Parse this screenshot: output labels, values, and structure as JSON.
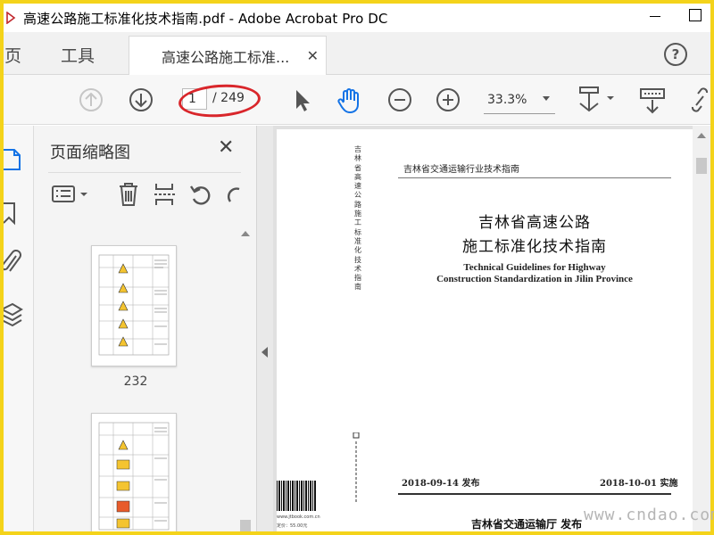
{
  "window": {
    "title": "高速公路施工标准化技术指南.pdf - Adobe Acrobat Pro DC"
  },
  "tabs": {
    "home": "主页",
    "tools": "工具",
    "document": "高速公路施工标准...",
    "close_glyph": "✕"
  },
  "toolbar": {
    "page_current": "1",
    "page_total": "/ 249",
    "zoom": "33.3%"
  },
  "thumbnails": {
    "title": "页面缩略图",
    "close_glyph": "✕",
    "pages": [
      {
        "label": "232"
      },
      {
        "label": ""
      }
    ]
  },
  "document": {
    "series": "吉林省交通运输行业技术指南",
    "spine_text": "吉林省高速公路施工标准化技术指南",
    "title_line1": "吉林省高速公路",
    "title_line2": "施工标准化技术指南",
    "english_line1": "Technical Guidelines for Highway",
    "english_line2": "Construction Standardization in Jilin Province",
    "publish_date": "2018-09-14 发布",
    "effective_date": "2018-10-01 实施",
    "issuer": "吉林省交通运输厅 发布",
    "website": "www.jtbook.com.cn",
    "price": "定价：55.00元"
  },
  "watermark": "www.cndao.com",
  "colors": {
    "frame": "#f4d31a",
    "annotation": "#d9262b",
    "active_icon": "#1473e6"
  }
}
